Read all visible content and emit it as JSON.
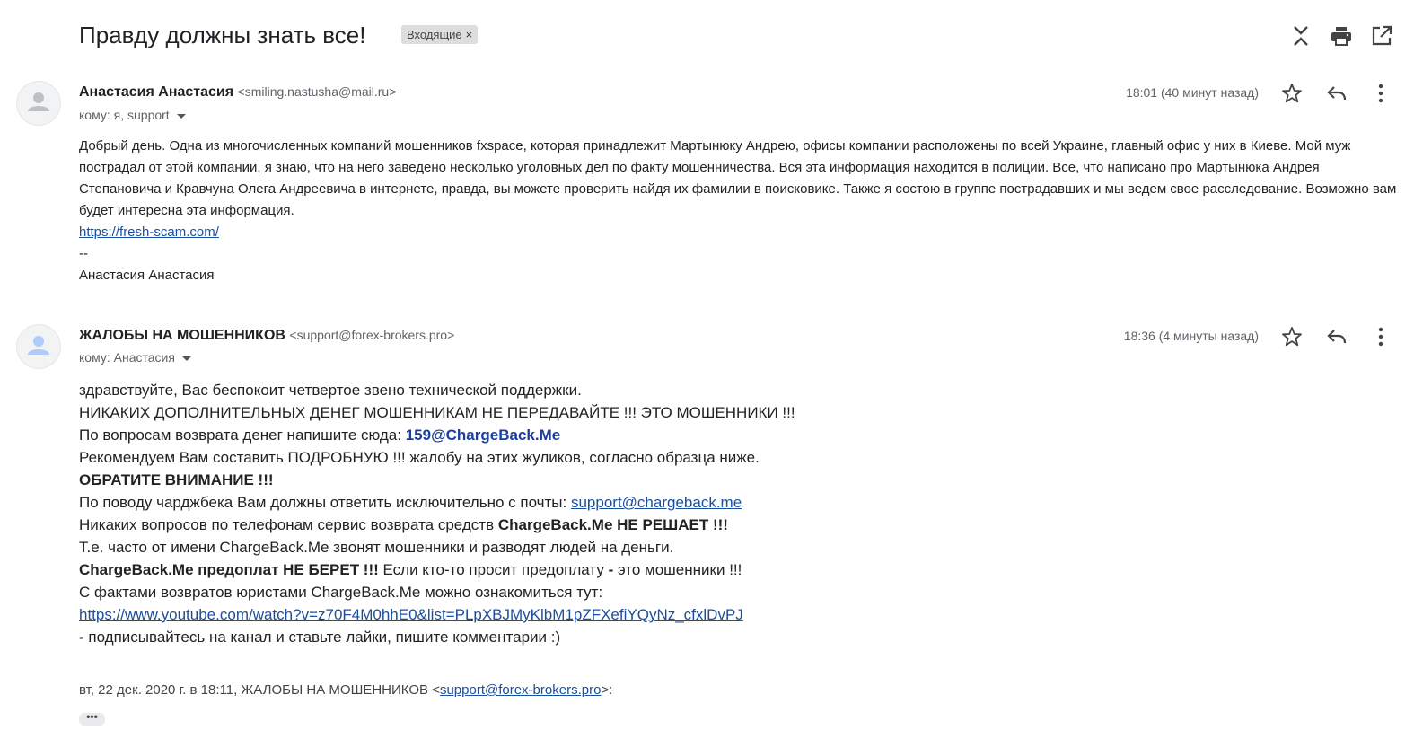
{
  "thread": {
    "subject": "Правду должны знать все!",
    "label": "Входящие",
    "label_remove": "×"
  },
  "messages": [
    {
      "sender_name": "Анастасия Анастасия",
      "sender_email": "<smiling.nastusha@mail.ru>",
      "to": "кому: я, support",
      "time": "18:01 (40 минут назад)",
      "body": [
        "Добрый день. Одна из многочисленных компаний мошенников fxspace, которая принадлежит Мартынюку Андрею, офисы компании расположены по всей Украине, главный офис у них в Киеве. Мой муж пострадал от этой компании, я знаю, что на него заведено несколько уголовных дел по факту мошенничества. Вся эта информация находится в полиции. Все, что написано про Мартынюка Андрея Степановича и Кравчуна Олега Андреевича в интернете, правда, вы можете проверить найдя их фамилии в поисковике. Также я состою в группе пострадавших и мы ведем свое расследование. Возможно вам будет интересна эта информация."
      ],
      "link": "https://fresh-scam.com/",
      "sig_sep": "--",
      "signature": "Анастасия Анастасия"
    },
    {
      "sender_name": "ЖАЛОБЫ НА МОШЕННИКОВ",
      "sender_email": "<support@forex-brokers.pro>",
      "to": "кому: Анастасия",
      "time": "18:36 (4 минуты назад)",
      "lines": {
        "l1": "здравствуйте, Вас беспокоит четвертое звено технической поддержки.",
        "l2": "НИКАКИХ ДОПОЛНИТЕЛЬНЫХ ДЕНЕГ МОШЕННИКАМ НЕ ПЕРЕДАВАЙТЕ !!! ЭТО МОШЕННИКИ !!!",
        "l3a": "По вопросам возврата денег напишите сюда: ",
        "l3b": "159@ChargeBack.Me",
        "l4": "Рекомендуем Вам составить ПОДРОБНУЮ !!! жалобу на этих жуликов, согласно образца ниже.",
        "l5": "ОБРАТИТЕ ВНИМАНИЕ !!!",
        "l6a": "По поводу чарджбека Вам должны ответить исключительно с почты: ",
        "l6b": "support@chargeback.me",
        "l7a": "Никаких вопросов по телефонам сервис возврата средств ",
        "l7b": "ChargeBack.Me НЕ РЕШАЕТ !!!",
        "l8": "Т.е. часто от имени ChargeBack.Me звонят мошенники и разводят людей на деньги.",
        "l9a": "ChargeBack.Me предоплат НЕ БЕРЕТ !!!",
        "l9b": " Если кто-то просит предоплату ",
        "l9c": "-",
        "l9d": " это мошенники !!!",
        "l10": "С фактами возвратов юристами ChargeBack.Me можно ознакомиться тут:",
        "l11": "https://www.youtube.com/watch?v=z70F4M0hhE0&list=PLpXBJMyKlbM1pZFXefiYQyNz_cfxlDvPJ",
        "l12a": " - ",
        "l12b": "подписывайтесь на канал и ставьте лайки, пишите комментарии :)"
      },
      "quote_prefix": "вт, 22 дек. 2020 г. в 18:11, ЖАЛОБЫ НА МОШЕННИКОВ <",
      "quote_email": "support@forex-brokers.pro",
      "quote_suffix": ">:",
      "ellipsis": "•••"
    }
  ],
  "icons": [
    "collapse-all-icon",
    "print-icon",
    "open-in-new-window-icon",
    "star-icon",
    "reply-icon",
    "more-vert-icon",
    "avatar-person-icon"
  ],
  "colors": {
    "link": "#1a4fa0",
    "chargeback_email": "#1a3fa0",
    "avatar_bg": "#f1f3f4"
  }
}
